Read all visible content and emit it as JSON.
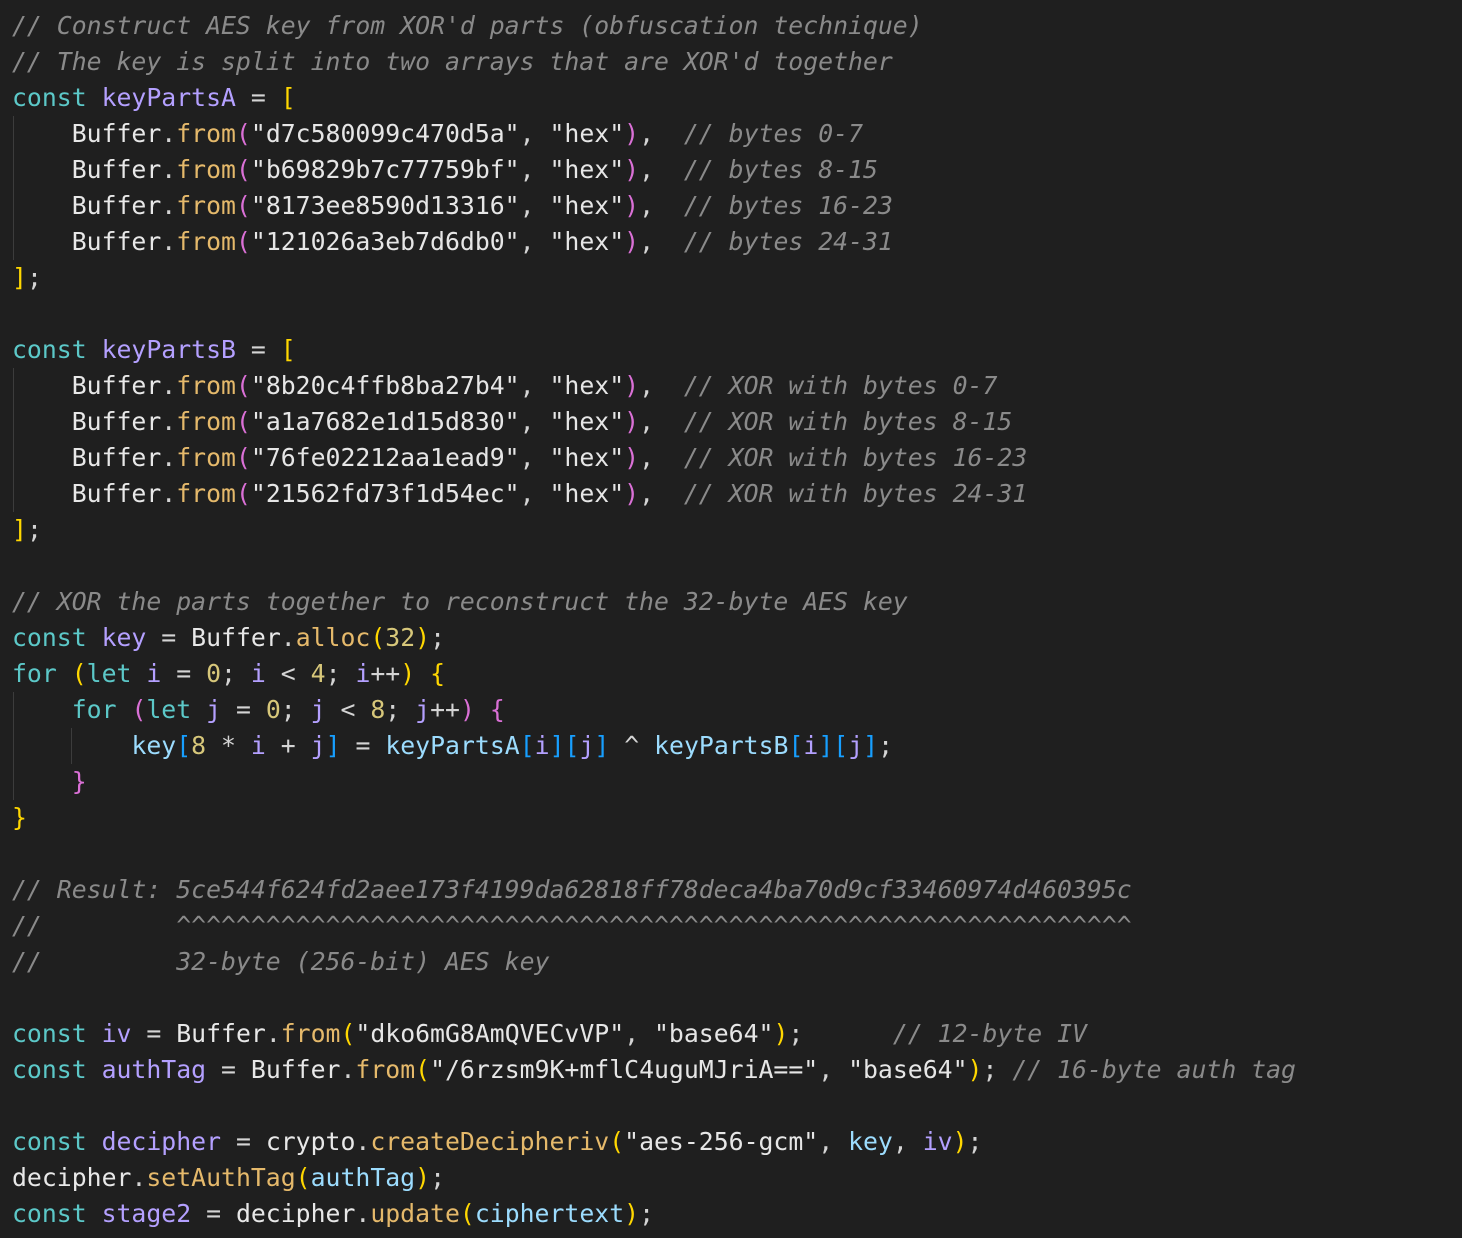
{
  "lines": [
    {
      "row": 0,
      "segs": [
        [
          "cg",
          "// Construct AES key from XOR'd parts (obfuscation technique)"
        ]
      ]
    },
    {
      "row": 1,
      "segs": [
        [
          "cg",
          "// The key is split into two arrays that are XOR'd together"
        ]
      ]
    },
    {
      "row": 2,
      "segs": [
        [
          "kw2",
          "const "
        ],
        [
          "vp",
          "keyPartsA"
        ],
        [
          "op",
          " = "
        ],
        [
          "br1",
          "["
        ]
      ]
    },
    {
      "row": 3,
      "segs": [
        [
          "pn",
          "    "
        ],
        [
          "ty",
          "Buffer"
        ],
        [
          "pn",
          "."
        ],
        [
          "fo",
          "from"
        ],
        [
          "br2",
          "("
        ],
        [
          "str2",
          "\"d7c580099c470d5a\""
        ],
        [
          "pn",
          ", "
        ],
        [
          "str2",
          "\"hex\""
        ],
        [
          "br2",
          ")"
        ],
        [
          "pn",
          ",  "
        ],
        [
          "cg",
          "// bytes 0-7"
        ]
      ]
    },
    {
      "row": 4,
      "segs": [
        [
          "pn",
          "    "
        ],
        [
          "ty",
          "Buffer"
        ],
        [
          "pn",
          "."
        ],
        [
          "fo",
          "from"
        ],
        [
          "br2",
          "("
        ],
        [
          "str2",
          "\"b69829b7c77759bf\""
        ],
        [
          "pn",
          ", "
        ],
        [
          "str2",
          "\"hex\""
        ],
        [
          "br2",
          ")"
        ],
        [
          "pn",
          ",  "
        ],
        [
          "cg",
          "// bytes 8-15"
        ]
      ]
    },
    {
      "row": 5,
      "segs": [
        [
          "pn",
          "    "
        ],
        [
          "ty",
          "Buffer"
        ],
        [
          "pn",
          "."
        ],
        [
          "fo",
          "from"
        ],
        [
          "br2",
          "("
        ],
        [
          "str2",
          "\"8173ee8590d13316\""
        ],
        [
          "pn",
          ", "
        ],
        [
          "str2",
          "\"hex\""
        ],
        [
          "br2",
          ")"
        ],
        [
          "pn",
          ",  "
        ],
        [
          "cg",
          "// bytes 16-23"
        ]
      ]
    },
    {
      "row": 6,
      "segs": [
        [
          "pn",
          "    "
        ],
        [
          "ty",
          "Buffer"
        ],
        [
          "pn",
          "."
        ],
        [
          "fo",
          "from"
        ],
        [
          "br2",
          "("
        ],
        [
          "str2",
          "\"121026a3eb7d6db0\""
        ],
        [
          "pn",
          ", "
        ],
        [
          "str2",
          "\"hex\""
        ],
        [
          "br2",
          ")"
        ],
        [
          "pn",
          ",  "
        ],
        [
          "cg",
          "// bytes 24-31"
        ]
      ]
    },
    {
      "row": 7,
      "segs": [
        [
          "br1",
          "]"
        ],
        [
          "pn",
          ";"
        ]
      ]
    },
    {
      "row": 9,
      "segs": [
        [
          "kw2",
          "const "
        ],
        [
          "vp",
          "keyPartsB"
        ],
        [
          "op",
          " = "
        ],
        [
          "br1",
          "["
        ]
      ]
    },
    {
      "row": 10,
      "segs": [
        [
          "pn",
          "    "
        ],
        [
          "ty",
          "Buffer"
        ],
        [
          "pn",
          "."
        ],
        [
          "fo",
          "from"
        ],
        [
          "br2",
          "("
        ],
        [
          "str2",
          "\"8b20c4ffb8ba27b4\""
        ],
        [
          "pn",
          ", "
        ],
        [
          "str2",
          "\"hex\""
        ],
        [
          "br2",
          ")"
        ],
        [
          "pn",
          ",  "
        ],
        [
          "cg",
          "// XOR with bytes 0-7"
        ]
      ]
    },
    {
      "row": 11,
      "segs": [
        [
          "pn",
          "    "
        ],
        [
          "ty",
          "Buffer"
        ],
        [
          "pn",
          "."
        ],
        [
          "fo",
          "from"
        ],
        [
          "br2",
          "("
        ],
        [
          "str2",
          "\"a1a7682e1d15d830\""
        ],
        [
          "pn",
          ", "
        ],
        [
          "str2",
          "\"hex\""
        ],
        [
          "br2",
          ")"
        ],
        [
          "pn",
          ",  "
        ],
        [
          "cg",
          "// XOR with bytes 8-15"
        ]
      ]
    },
    {
      "row": 12,
      "segs": [
        [
          "pn",
          "    "
        ],
        [
          "ty",
          "Buffer"
        ],
        [
          "pn",
          "."
        ],
        [
          "fo",
          "from"
        ],
        [
          "br2",
          "("
        ],
        [
          "str2",
          "\"76fe02212aa1ead9\""
        ],
        [
          "pn",
          ", "
        ],
        [
          "str2",
          "\"hex\""
        ],
        [
          "br2",
          ")"
        ],
        [
          "pn",
          ",  "
        ],
        [
          "cg",
          "// XOR with bytes 16-23"
        ]
      ]
    },
    {
      "row": 13,
      "segs": [
        [
          "pn",
          "    "
        ],
        [
          "ty",
          "Buffer"
        ],
        [
          "pn",
          "."
        ],
        [
          "fo",
          "from"
        ],
        [
          "br2",
          "("
        ],
        [
          "str2",
          "\"21562fd73f1d54ec\""
        ],
        [
          "pn",
          ", "
        ],
        [
          "str2",
          "\"hex\""
        ],
        [
          "br2",
          ")"
        ],
        [
          "pn",
          ",  "
        ],
        [
          "cg",
          "// XOR with bytes 24-31"
        ]
      ]
    },
    {
      "row": 14,
      "segs": [
        [
          "br1",
          "]"
        ],
        [
          "pn",
          ";"
        ]
      ]
    },
    {
      "row": 16,
      "segs": [
        [
          "cg",
          "// XOR the parts together to reconstruct the 32-byte AES key"
        ]
      ]
    },
    {
      "row": 17,
      "segs": [
        [
          "kw2",
          "const "
        ],
        [
          "vp",
          "key"
        ],
        [
          "op",
          " = "
        ],
        [
          "ty",
          "Buffer"
        ],
        [
          "pn",
          "."
        ],
        [
          "fo",
          "alloc"
        ],
        [
          "br1",
          "("
        ],
        [
          "num",
          "32"
        ],
        [
          "br1",
          ")"
        ],
        [
          "pn",
          ";"
        ]
      ]
    },
    {
      "row": 18,
      "segs": [
        [
          "kw2",
          "for "
        ],
        [
          "br1",
          "("
        ],
        [
          "kw2",
          "let "
        ],
        [
          "vp",
          "i"
        ],
        [
          "op",
          " = "
        ],
        [
          "num",
          "0"
        ],
        [
          "pn",
          "; "
        ],
        [
          "vp",
          "i"
        ],
        [
          "op",
          " < "
        ],
        [
          "num",
          "4"
        ],
        [
          "pn",
          "; "
        ],
        [
          "vp",
          "i"
        ],
        [
          "op",
          "++"
        ],
        [
          "br1",
          ")"
        ],
        [
          "pn",
          " "
        ],
        [
          "br1",
          "{"
        ]
      ]
    },
    {
      "row": 19,
      "segs": [
        [
          "pn",
          "    "
        ],
        [
          "kw2",
          "for "
        ],
        [
          "br2",
          "("
        ],
        [
          "kw2",
          "let "
        ],
        [
          "vp",
          "j"
        ],
        [
          "op",
          " = "
        ],
        [
          "num",
          "0"
        ],
        [
          "pn",
          "; "
        ],
        [
          "vp",
          "j"
        ],
        [
          "op",
          " < "
        ],
        [
          "num",
          "8"
        ],
        [
          "pn",
          "; "
        ],
        [
          "vp",
          "j"
        ],
        [
          "op",
          "++"
        ],
        [
          "br2",
          ")"
        ],
        [
          "pn",
          " "
        ],
        [
          "br2",
          "{"
        ]
      ]
    },
    {
      "row": 20,
      "segs": [
        [
          "pn",
          "        "
        ],
        [
          "var",
          "key"
        ],
        [
          "br3",
          "["
        ],
        [
          "num",
          "8"
        ],
        [
          "op",
          " * "
        ],
        [
          "vp",
          "i"
        ],
        [
          "op",
          " + "
        ],
        [
          "vp",
          "j"
        ],
        [
          "br3",
          "]"
        ],
        [
          "op",
          " = "
        ],
        [
          "var",
          "keyPartsA"
        ],
        [
          "br3",
          "["
        ],
        [
          "vp",
          "i"
        ],
        [
          "br3",
          "]"
        ],
        [
          "br3",
          "["
        ],
        [
          "vp",
          "j"
        ],
        [
          "br3",
          "]"
        ],
        [
          "op",
          " ^ "
        ],
        [
          "var",
          "keyPartsB"
        ],
        [
          "br3",
          "["
        ],
        [
          "vp",
          "i"
        ],
        [
          "br3",
          "]"
        ],
        [
          "br3",
          "["
        ],
        [
          "vp",
          "j"
        ],
        [
          "br3",
          "]"
        ],
        [
          "pn",
          ";"
        ]
      ]
    },
    {
      "row": 21,
      "segs": [
        [
          "pn",
          "    "
        ],
        [
          "br2",
          "}"
        ]
      ]
    },
    {
      "row": 22,
      "segs": [
        [
          "br1",
          "}"
        ]
      ]
    },
    {
      "row": 24,
      "segs": [
        [
          "cg",
          "// Result: 5ce544f624fd2aee173f4199da62818ff78deca4ba70d9cf33460974d460395c"
        ]
      ]
    },
    {
      "row": 25,
      "segs": [
        [
          "cg",
          "//         ^^^^^^^^^^^^^^^^^^^^^^^^^^^^^^^^^^^^^^^^^^^^^^^^^^^^^^^^^^^^^^^^"
        ]
      ]
    },
    {
      "row": 26,
      "segs": [
        [
          "cg",
          "//         32-byte (256-bit) AES key"
        ]
      ]
    },
    {
      "row": 28,
      "segs": [
        [
          "kw2",
          "const "
        ],
        [
          "vp",
          "iv"
        ],
        [
          "op",
          " = "
        ],
        [
          "ty",
          "Buffer"
        ],
        [
          "pn",
          "."
        ],
        [
          "fo",
          "from"
        ],
        [
          "br1",
          "("
        ],
        [
          "str2",
          "\"dko6mG8AmQVECvVP\""
        ],
        [
          "pn",
          ", "
        ],
        [
          "str2",
          "\"base64\""
        ],
        [
          "br1",
          ")"
        ],
        [
          "pn",
          ";      "
        ],
        [
          "cg",
          "// 12-byte IV"
        ]
      ]
    },
    {
      "row": 29,
      "segs": [
        [
          "kw2",
          "const "
        ],
        [
          "vp",
          "authTag"
        ],
        [
          "op",
          " = "
        ],
        [
          "ty",
          "Buffer"
        ],
        [
          "pn",
          "."
        ],
        [
          "fo",
          "from"
        ],
        [
          "br1",
          "("
        ],
        [
          "str2",
          "\"/6rzsm9K+mflC4uguMJriA==\""
        ],
        [
          "pn",
          ", "
        ],
        [
          "str2",
          "\"base64\""
        ],
        [
          "br1",
          ")"
        ],
        [
          "pn",
          "; "
        ],
        [
          "cg",
          "// 16-byte auth tag"
        ]
      ]
    },
    {
      "row": 31,
      "segs": [
        [
          "kw2",
          "const "
        ],
        [
          "vp",
          "decipher"
        ],
        [
          "op",
          " = "
        ],
        [
          "ty",
          "crypto"
        ],
        [
          "pn",
          "."
        ],
        [
          "fo",
          "createDecipheriv"
        ],
        [
          "br1",
          "("
        ],
        [
          "str2",
          "\"aes-256-gcm\""
        ],
        [
          "pn",
          ", "
        ],
        [
          "var",
          "key"
        ],
        [
          "pn",
          ", "
        ],
        [
          "vp",
          "iv"
        ],
        [
          "br1",
          ")"
        ],
        [
          "pn",
          ";"
        ]
      ]
    },
    {
      "row": 32,
      "segs": [
        [
          "ty",
          "decipher"
        ],
        [
          "pn",
          "."
        ],
        [
          "fo",
          "setAuthTag"
        ],
        [
          "br1",
          "("
        ],
        [
          "var",
          "authTag"
        ],
        [
          "br1",
          ")"
        ],
        [
          "pn",
          ";"
        ]
      ]
    },
    {
      "row": 33,
      "segs": [
        [
          "kw2",
          "const "
        ],
        [
          "vp",
          "stage2"
        ],
        [
          "op",
          " = "
        ],
        [
          "ty",
          "decipher"
        ],
        [
          "pn",
          "."
        ],
        [
          "fo",
          "update"
        ],
        [
          "br1",
          "("
        ],
        [
          "var",
          "ciphertext"
        ],
        [
          "br1",
          ")"
        ],
        [
          "pn",
          ";"
        ]
      ]
    }
  ]
}
